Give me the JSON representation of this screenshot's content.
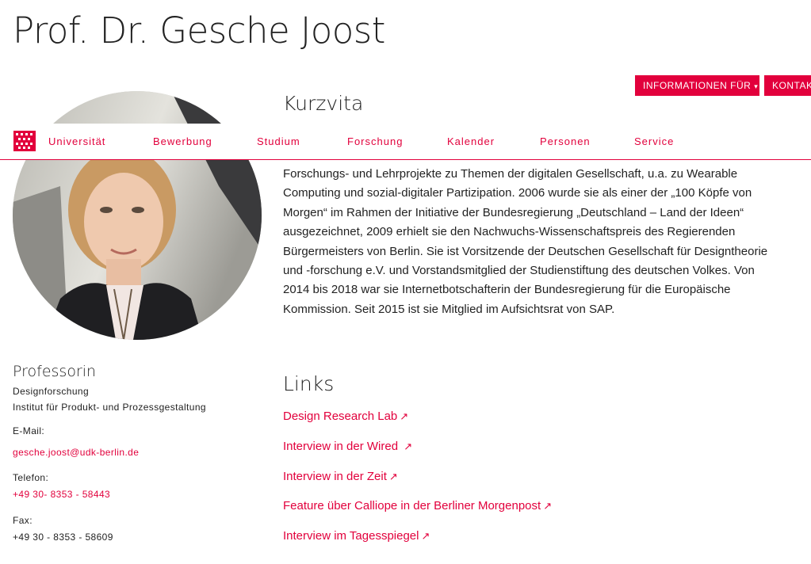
{
  "page": {
    "title": "Prof. Dr. Gesche Joost"
  },
  "header_buttons": {
    "info_label": "INFORMATIONEN FÜR",
    "info_caret": "▾",
    "contact_label": "KONTAKT"
  },
  "nav": {
    "items": [
      "Universität",
      "Bewerbung",
      "Studium",
      "Forschung",
      "Kalender",
      "Personen",
      "Service"
    ]
  },
  "kurzvita": {
    "heading": "Kurzvita",
    "lines": [
      "Forschungs- und Lehrprojekte zu Themen der digitalen Gesellschaft, u.a. zu Wearable",
      "Computing und sozial-digitaler Partizipation. 2006 wurde sie als einer der „100 Köpfe von",
      "Morgen“ im Rahmen der Initiative der Bundesregierung „Deutschland – Land der Ideen“",
      "ausgezeichnet, 2009 erhielt sie den Nachwuchs-Wissenschaftspreis des Regierenden",
      "Bürgermeisters von Berlin. Sie ist Vorsitzende der Deutschen Gesellschaft für Designtheorie",
      "und -forschung e.V. und Vorstandsmitglied der Studienstiftung des deutschen Volkes. Von",
      "2014 bis 2018 war sie Internetbotschafterin der Bundesregierung für die Europäische",
      "Kommission. Seit 2015 ist sie Mitglied im Aufsichtsrat von SAP."
    ]
  },
  "profile": {
    "role": "Professorin",
    "department": "Designforschung",
    "institute": "Institut für Produkt- und Prozessgestaltung",
    "email_label": "E-Mail:",
    "email": "gesche.joost@udk-berlin.de",
    "phone_label": "Telefon:",
    "phone": "+49 30- 8353 - 58443",
    "fax_label": "Fax:",
    "fax": "+49 30 - 8353 - 58609"
  },
  "links": {
    "heading": "Links",
    "arrow": "↗",
    "items": [
      "Design Research Lab",
      "Interview in der Wired ",
      "Interview in der Zeit",
      "Feature über Calliope in der Berliner Morgenpost",
      "Interview im Tagesspiegel"
    ]
  },
  "colors": {
    "accent": "#e2003c",
    "text": "#222222"
  }
}
